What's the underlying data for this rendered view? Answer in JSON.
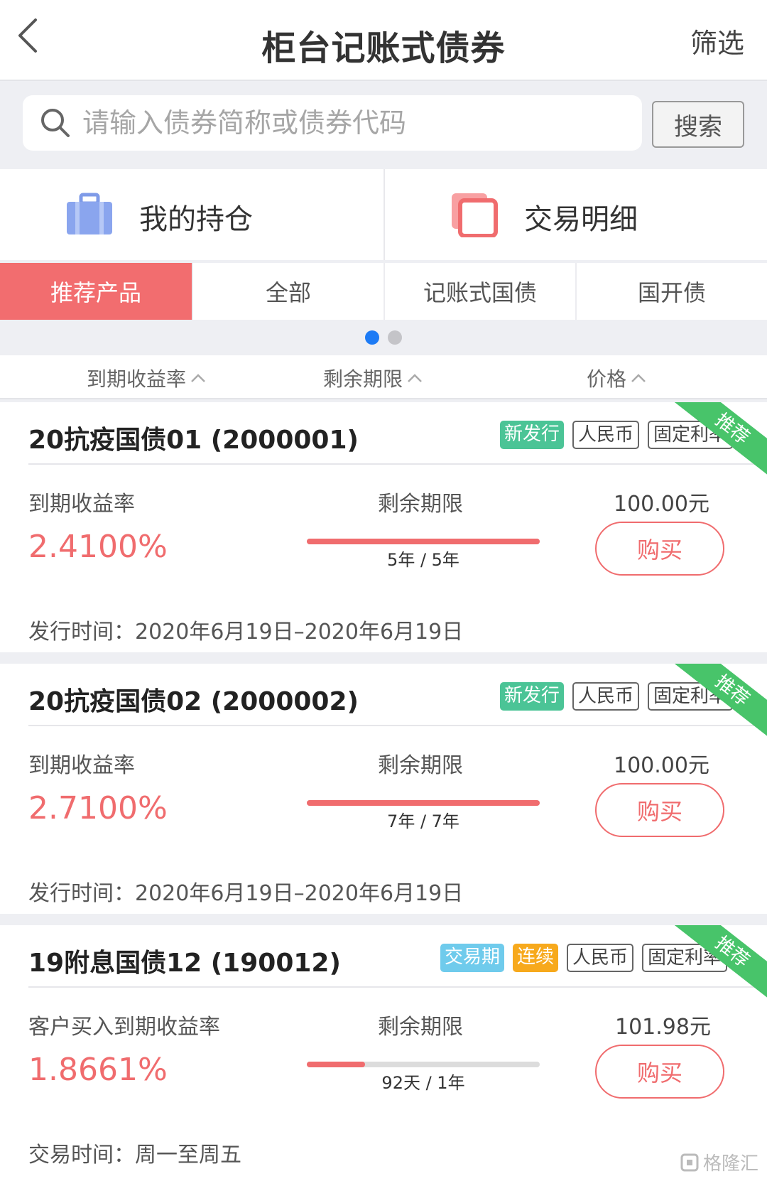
{
  "header": {
    "title": "柜台记账式债券",
    "filter_label": "筛选"
  },
  "search": {
    "placeholder": "请输入债券简称或债券代码",
    "button_label": "搜索"
  },
  "quick": {
    "holdings_label": "我的持仓",
    "details_label": "交易明细"
  },
  "tabs": [
    {
      "label": "推荐产品",
      "active": true
    },
    {
      "label": "全部"
    },
    {
      "label": "记账式国债"
    },
    {
      "label": "国开债"
    }
  ],
  "pager": {
    "current": 1,
    "total": 2
  },
  "sort": {
    "yield": "到期收益率",
    "term": "剩余期限",
    "price": "价格"
  },
  "bonds": [
    {
      "name": "20抗疫国债01 (2000001)",
      "tags": [
        "新发行",
        "人民币",
        "固定利率"
      ],
      "ribbon": "推荐",
      "yield_label": "到期收益率",
      "yield": "2.4100%",
      "term_label": "剩余期限",
      "term_text": "5年 / 5年",
      "term_progress": 1.0,
      "price": "100.00元",
      "buy_label": "购买",
      "issue_text": "发行时间：2020年6月19日–2020年6月19日"
    },
    {
      "name": "20抗疫国债02 (2000002)",
      "tags": [
        "新发行",
        "人民币",
        "固定利率"
      ],
      "ribbon": "推荐",
      "yield_label": "到期收益率",
      "yield": "2.7100%",
      "term_label": "剩余期限",
      "term_text": "7年 / 7年",
      "term_progress": 1.0,
      "price": "100.00元",
      "buy_label": "购买",
      "issue_text": "发行时间：2020年6月19日–2020年6月19日"
    },
    {
      "name": "19附息国债12 (190012)",
      "tags": [
        "交易期",
        "连续",
        "人民币",
        "固定利率"
      ],
      "ribbon": "推荐",
      "yield_label": "客户买入到期收益率",
      "yield": "1.8661%",
      "term_label": "剩余期限",
      "term_text": "92天 / 1年",
      "term_progress": 0.25,
      "price": "101.98元",
      "buy_label": "购买",
      "issue_text": "交易时间：周一至周五"
    }
  ],
  "watermark": "格隆汇",
  "colors": {
    "accent": "#f06c6e",
    "green_tag": "#4bc496",
    "blue_tag": "#6fcbec",
    "orange_tag": "#f7a91c",
    "ribbon": "#48c46a",
    "dot_active": "#1d7bf5"
  }
}
